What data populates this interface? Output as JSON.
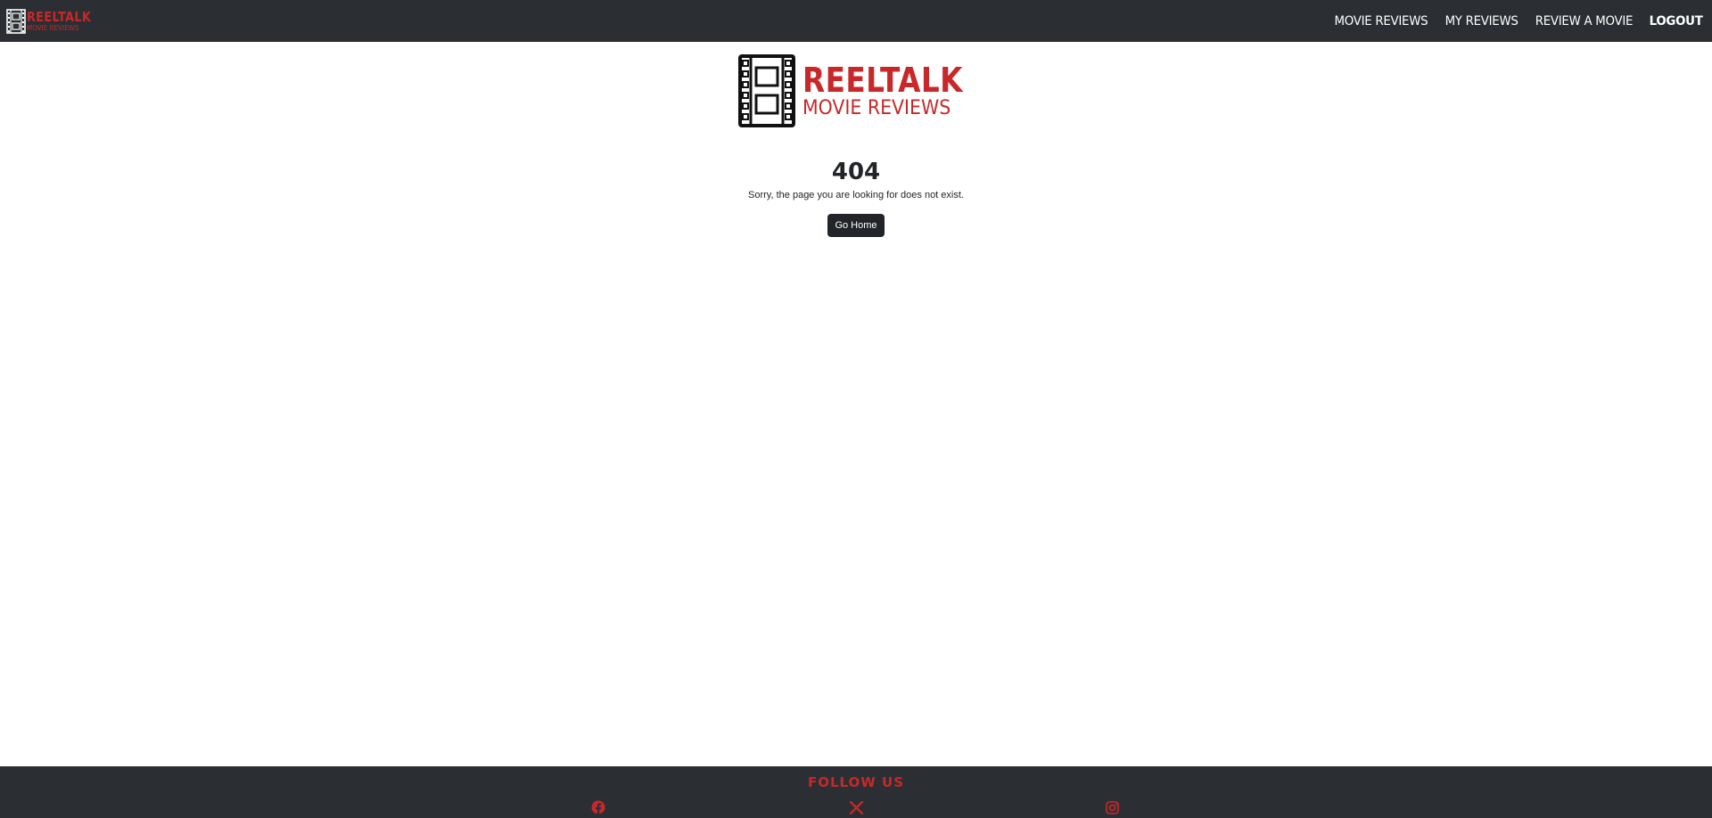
{
  "navbar": {
    "brand_title": "REELTALK",
    "brand_subtitle": "MOVIE REVIEWS",
    "links": [
      {
        "label": "Movie Reviews"
      },
      {
        "label": "My Reviews"
      },
      {
        "label": "Review a Movie"
      },
      {
        "label": "Logout"
      }
    ]
  },
  "hero": {
    "logo_title": "REELTALK",
    "logo_subtitle": "MOVIE REVIEWS"
  },
  "error": {
    "code": "404",
    "message": "Sorry, the page you are looking for does not exist.",
    "button_label": "Go Home"
  },
  "footer": {
    "heading": "FOLLOW US",
    "social_icons": [
      "facebook-icon",
      "x-icon",
      "instagram-icon"
    ]
  },
  "colors": {
    "brand_red": "#c8282a",
    "nav_bg": "#2b2f33",
    "button_bg": "#212529"
  }
}
